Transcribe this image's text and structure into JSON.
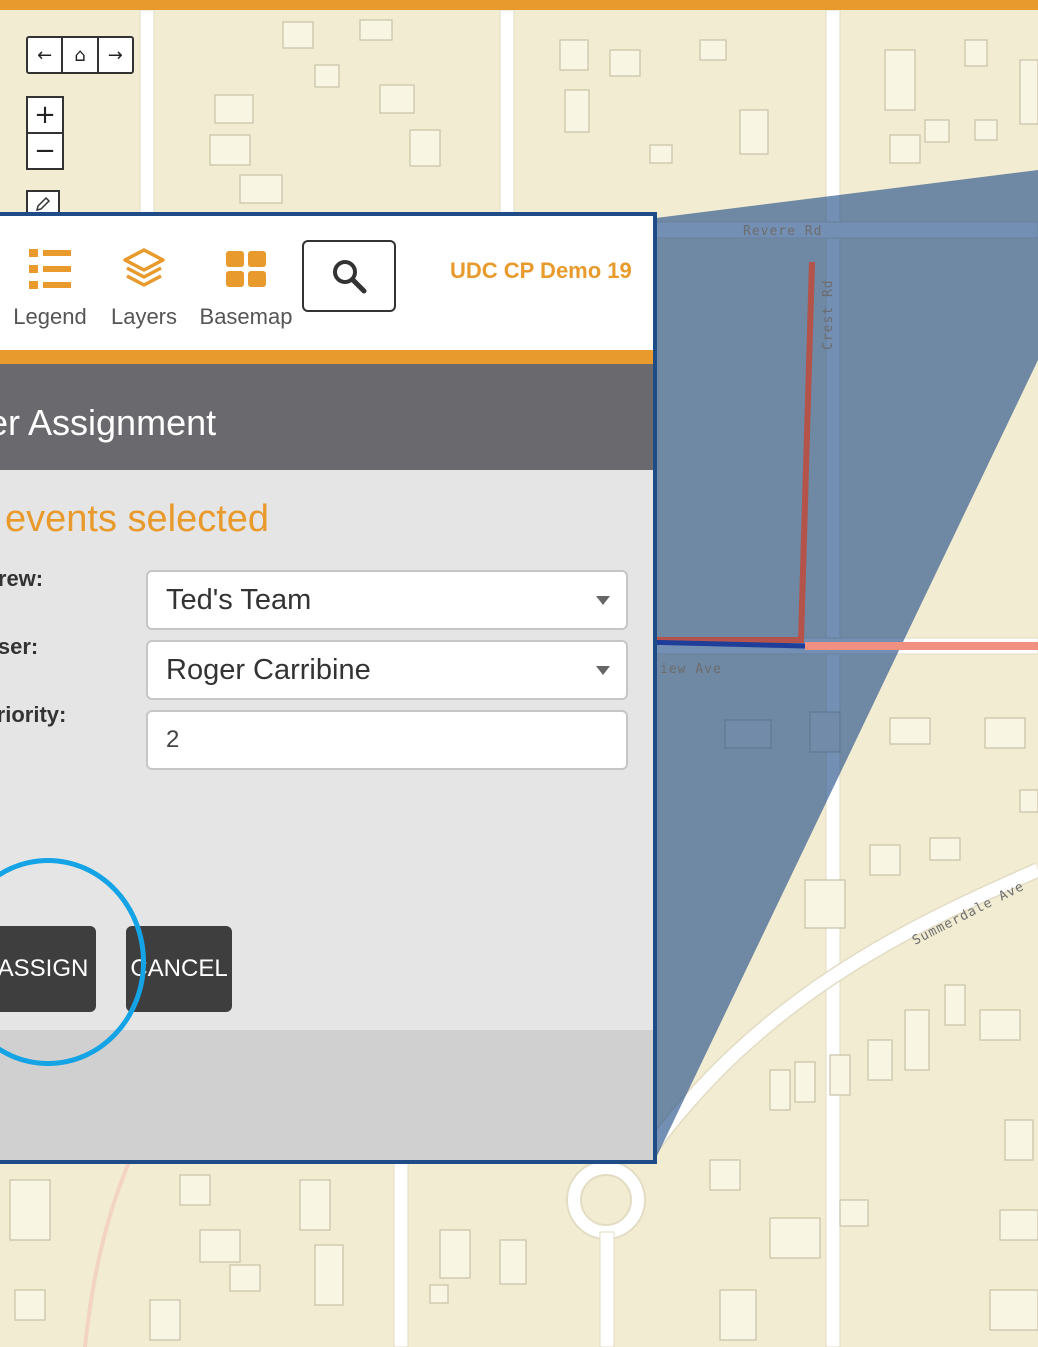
{
  "app": {
    "title": "UDC CP Demo 19"
  },
  "colors": {
    "accent": "#e89a2c",
    "header": "#6a6a6e",
    "panel_border": "#1f4b86",
    "highlight_circle": "#14a4e6"
  },
  "toolbar": {
    "legend": {
      "label": "Legend",
      "icon": "list-icon"
    },
    "layers": {
      "label": "Layers",
      "icon": "layers-icon"
    },
    "basemap": {
      "label": "Basemap",
      "icon": "grid-icon"
    },
    "search": {
      "icon": "search-icon"
    }
  },
  "map": {
    "streets": [
      "Revere Rd",
      "Crest Rd",
      "iew Ave",
      "Summerdale Ave"
    ],
    "nav": {
      "back_icon": "arrow-left-icon",
      "home_icon": "home-icon",
      "forward_icon": "arrow-right-icon"
    },
    "zoom_in": "+",
    "zoom_out": "−"
  },
  "dialog": {
    "title": "ser Assignment",
    "events_text": "l events selected",
    "crew": {
      "label": "Crew:",
      "value": "Ted's Team"
    },
    "user": {
      "label": "User:",
      "value": "Roger Carribine"
    },
    "priority": {
      "label": "Priority:",
      "value": "2"
    },
    "assign_label": "ASSIGN",
    "cancel_label": "CANCEL"
  }
}
